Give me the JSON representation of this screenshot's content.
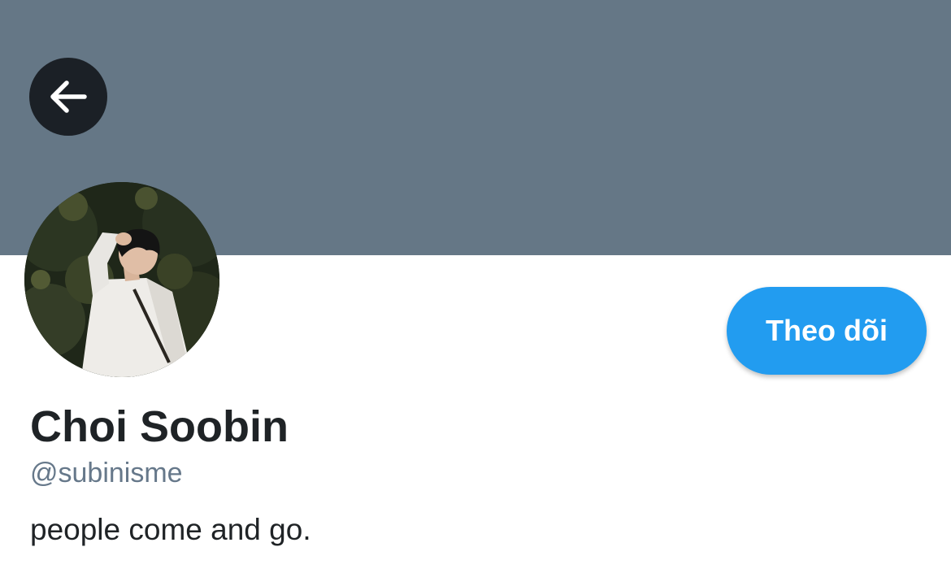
{
  "profile": {
    "banner_color": "#657786",
    "back_button": {
      "icon": "arrow-left-icon",
      "color": "#1b2026"
    },
    "avatar": {
      "alt": "Choi Soobin"
    },
    "follow_label": "Theo dõi",
    "follow_color": "#229cf0",
    "display_name": "Choi Soobin",
    "handle": "@subinisme",
    "bio": "people come and go."
  }
}
